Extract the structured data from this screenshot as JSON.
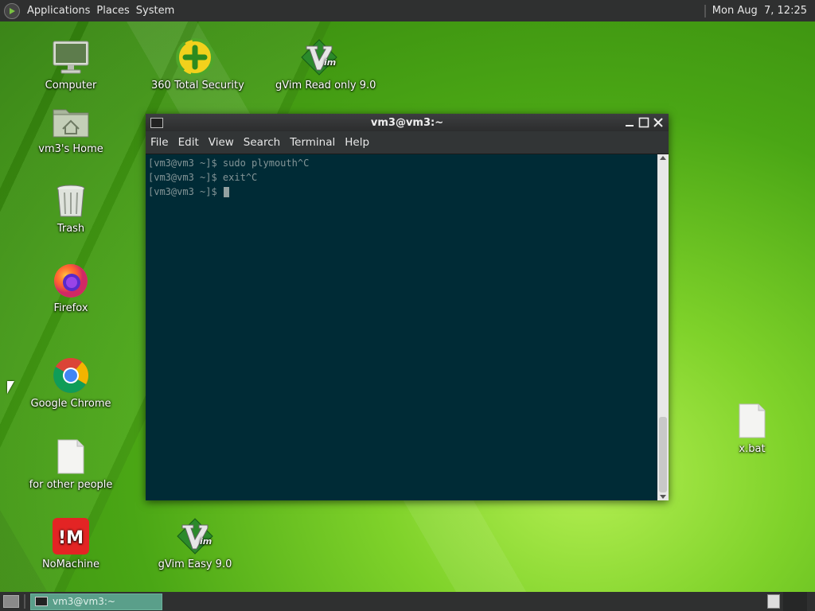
{
  "top_panel": {
    "menus": [
      "Applications",
      "Places",
      "System"
    ],
    "clock": "Mon Aug  7, 12:25"
  },
  "desktop_icons": [
    {
      "label": "Computer",
      "icon": "computer-icon"
    },
    {
      "label": "vm3's Home",
      "icon": "home-folder-icon"
    },
    {
      "label": "Trash",
      "icon": "trash-icon"
    },
    {
      "label": "Firefox",
      "icon": "firefox-icon"
    },
    {
      "label": "Google Chrome",
      "icon": "chrome-icon"
    },
    {
      "label": "for other people",
      "icon": "document-icon"
    },
    {
      "label": "NoMachine",
      "icon": "nomachine-icon"
    },
    {
      "label": "360 Total Security",
      "icon": "security-icon"
    },
    {
      "label": "gVim Read only 9.0",
      "icon": "gvim-icon"
    },
    {
      "label": "gVim Easy 9.0",
      "icon": "gvim-icon"
    },
    {
      "label": "x.bat",
      "icon": "document-icon"
    }
  ],
  "terminal": {
    "title": "vm3@vm3:~",
    "menu": [
      "File",
      "Edit",
      "View",
      "Search",
      "Terminal",
      "Help"
    ],
    "lines": [
      "[vm3@vm3 ~]$ sudo plymouth^C",
      "[vm3@vm3 ~]$ exit^C",
      "[vm3@vm3 ~]$ "
    ],
    "bg_color": "#002b36",
    "fg_color": "#839496"
  },
  "taskbar": {
    "task_label": "vm3@vm3:~"
  }
}
